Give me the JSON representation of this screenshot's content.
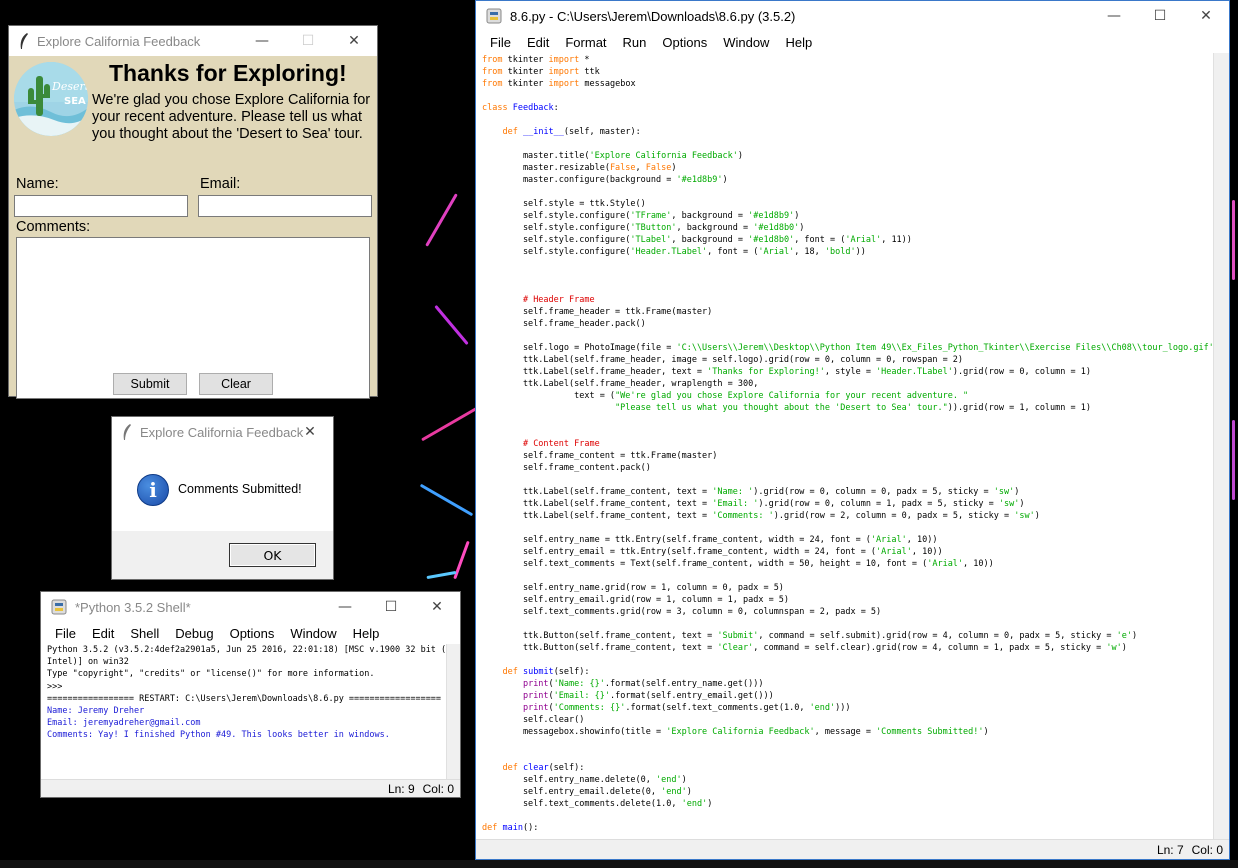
{
  "feedback_window": {
    "title": "Explore California Feedback",
    "header_title": "Thanks for Exploring!",
    "header_text": "We're glad you chose Explore California for your recent adventure. Please tell us what you thought about the 'Desert to Sea' tour.",
    "logo_text_top": "Desert",
    "logo_text_bottom": "SEA",
    "name_label": "Name:",
    "email_label": "Email:",
    "comments_label": "Comments:",
    "submit_label": "Submit",
    "clear_label": "Clear",
    "background_color": "#e1d8b9"
  },
  "dialog": {
    "title": "Explore California Feedback",
    "message": "Comments Submitted!",
    "ok_label": "OK",
    "icon": "info-icon"
  },
  "shell": {
    "title": "*Python 3.5.2 Shell*",
    "menu": [
      "File",
      "Edit",
      "Shell",
      "Debug",
      "Options",
      "Window",
      "Help"
    ],
    "lines": [
      "Python 3.5.2 (v3.5.2:4def2a2901a5, Jun 25 2016, 22:01:18) [MSC v.1900 32 bit (",
      "Intel)] on win32",
      "Type \"copyright\", \"credits\" or \"license()\" for more information.",
      ">>> ",
      "================= RESTART: C:\\Users\\Jerem\\Downloads\\8.6.py =================="
    ],
    "output_lines": [
      "Name: Jeremy Dreher",
      "Email: jeremyadreher@gmail.com",
      "Comments: Yay! I finished Python #49. This looks better in windows."
    ],
    "status_ln": "Ln: 9",
    "status_col": "Col: 0"
  },
  "editor": {
    "title": "8.6.py - C:\\Users\\Jerem\\Downloads\\8.6.py (3.5.2)",
    "menu": [
      "File",
      "Edit",
      "Format",
      "Run",
      "Options",
      "Window",
      "Help"
    ],
    "status_ln": "Ln: 7",
    "status_col": "Col: 0"
  }
}
